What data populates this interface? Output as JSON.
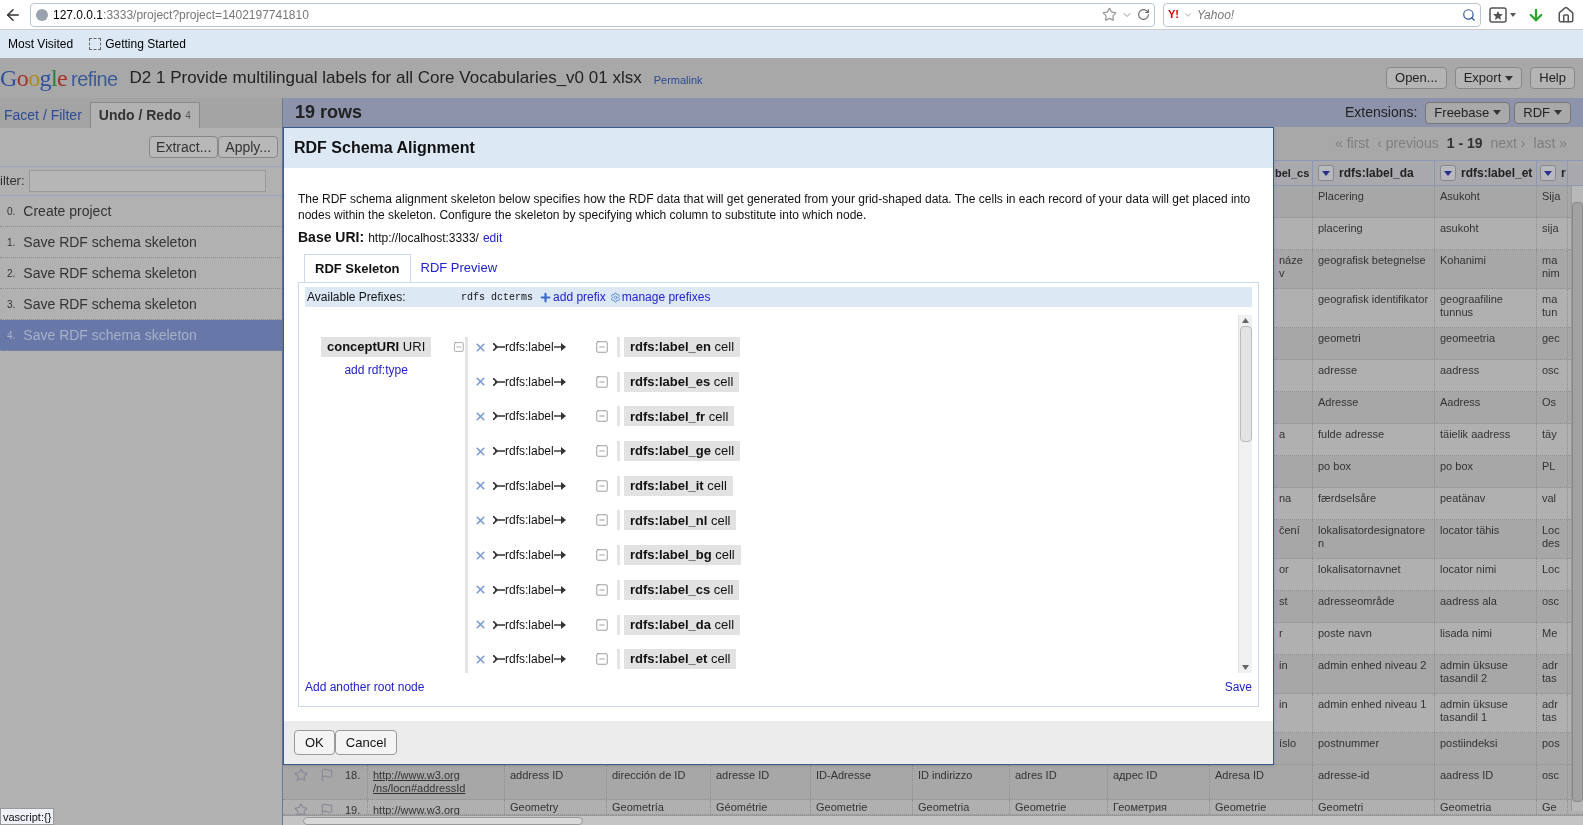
{
  "browser": {
    "url_host": "127.0.0.1",
    "url_rest": ":3333/project?project=1402197741810",
    "search": {
      "logo_text": "Y!",
      "placeholder": "Yahoo!"
    },
    "bookmarks": [
      "Most Visited",
      "Getting Started"
    ]
  },
  "app": {
    "logo": "Google",
    "logo_suffix": "refine",
    "project_title": "D2 1 Provide multilingual labels for all Core Vocabularies_v0 01 xlsx",
    "permalink": "Permalink",
    "buttons": [
      {
        "label": "Open...",
        "dropdown": false
      },
      {
        "label": "Export",
        "dropdown": true
      },
      {
        "label": "Help",
        "dropdown": false
      }
    ]
  },
  "left_panel": {
    "tabs": [
      {
        "label": "Facet / Filter",
        "selected": false
      },
      {
        "label": "Undo / Redo",
        "count": "4",
        "selected": true
      }
    ],
    "buttons": [
      "Extract...",
      "Apply..."
    ],
    "filter_label": "ilter:",
    "history": [
      {
        "number": "0.",
        "label": "Create project",
        "selected": false
      },
      {
        "number": "1.",
        "label": "Save RDF schema skeleton",
        "selected": false
      },
      {
        "number": "2.",
        "label": "Save RDF schema skeleton",
        "selected": false
      },
      {
        "number": "3.",
        "label": "Save RDF schema skeleton",
        "selected": false
      },
      {
        "number": "4.",
        "label": "Save RDF schema skeleton",
        "selected": true
      }
    ]
  },
  "grid": {
    "row_count": "19 rows",
    "extensions_label": "Extensions:",
    "extensions": [
      "Freebase",
      "RDF"
    ],
    "pager": {
      "first": "« first",
      "previous": "‹ previous",
      "range_start": "1",
      "range_sep": "-",
      "range_end": "19",
      "next": "next ›",
      "last": "last »"
    },
    "columns": [
      "bel_cs",
      "rdfs:label_da",
      "rdfs:label_et",
      "r"
    ],
    "rows": [
      {
        "cs": "",
        "da": "Placering",
        "et": "Asukoht",
        "col_4": [
          "Sija"
        ]
      },
      {
        "cs": "",
        "da": "placering",
        "et": "asukoht",
        "col_4": [
          "sija"
        ]
      },
      {
        "cs": "název",
        "da": "geografisk betegnelse",
        "et": "Kohanimi",
        "col_4": [
          "ma",
          "nim"
        ]
      },
      {
        "cs": "",
        "da": "geografisk identifikator",
        "et": "geograafiline tunnus",
        "col_4": [
          "ma",
          "tun"
        ]
      },
      {
        "cs": "",
        "da": "geometri",
        "et": "geomeetria",
        "col_4": [
          "gec"
        ]
      },
      {
        "cs": "",
        "da": "adresse",
        "et": "aadress",
        "col_4": [
          "osc"
        ]
      },
      {
        "cs": "",
        "da": "Adresse",
        "et": "Aadress",
        "col_4": [
          "Os"
        ]
      },
      {
        "cs": "a",
        "da": "fulde adresse",
        "et": "täielik aadress",
        "col_4": [
          "täy"
        ]
      },
      {
        "cs": "",
        "da": "po box",
        "et": "po box",
        "col_4": [
          "PL"
        ]
      },
      {
        "cs": "na",
        "da": "færdselsåre",
        "et": "peatänav",
        "col_4": [
          "val"
        ]
      },
      {
        "cs": "čení",
        "da": "lokalisatordesignatoren",
        "et": "locator tähis",
        "col_4": [
          "Loc",
          "des"
        ]
      },
      {
        "cs": "or",
        "da": "lokalisatornavnet",
        "et": "locator nimi",
        "col_4": [
          "Loc"
        ]
      },
      {
        "cs": "st",
        "da": "adresseområde",
        "et": "aadress ala",
        "col_4": [
          "osc"
        ]
      },
      {
        "cs": "r",
        "da": "poste navn",
        "et": "lisada nimi",
        "col_4": [
          "Me"
        ]
      },
      {
        "cs": "in",
        "da": "admin enhed niveau 2",
        "et": "admin üksuse tasandil 2",
        "col_4": [
          "adr",
          "tas"
        ]
      },
      {
        "cs": "in",
        "da": "admin enhed niveau 1",
        "et": "admin üksuse tasandil 1",
        "col_4": [
          "adr",
          "tas"
        ]
      },
      {
        "cs": "íslo",
        "da": "postnummer",
        "et": "postiindeksi",
        "col_4": [
          "pos"
        ]
      }
    ],
    "full_rows": [
      {
        "number": "18.",
        "link": [
          "http://www.w3.org",
          "/ns/locn#addressId"
        ],
        "cells": [
          "address ID",
          "dirección de ID",
          "adresse ID",
          "ID-Adresse",
          "ID indirizzo",
          "adres ID",
          "адрес ID",
          "Adresa ID",
          "adresse-id",
          "aadress ID",
          "osc"
        ]
      },
      {
        "number": "19.",
        "link": [
          "http://www.w3.org"
        ],
        "cells": [
          "Geometry",
          "Geometría",
          "Géométrie",
          "Geometrie",
          "Geometria",
          "Geometrie",
          "Геометрия",
          "Geometrie",
          "Geometri",
          "Geometria",
          "Ge"
        ]
      }
    ]
  },
  "dialog": {
    "title": "RDF Schema Alignment",
    "description": "The RDF schema alignment skeleton below specifies how the RDF data that will get generated from your grid-shaped data. The cells in each record of your data will get placed into nodes within the skeleton. Configure the skeleton by specifying which column to substitute into which node.",
    "base_uri_label": "Base URI:",
    "base_uri": "http://localhost:3333/",
    "edit": "edit",
    "tabs": [
      {
        "label": "RDF Skeleton",
        "selected": true
      },
      {
        "label": "RDF Preview",
        "selected": false
      }
    ],
    "prefixes_label": "Available Prefixes:",
    "prefixes": [
      "rdfs",
      "dcterms"
    ],
    "add_prefix": "add prefix",
    "manage_prefixes": "manage prefixes",
    "root": {
      "column": "conceptURI",
      "type": "URI",
      "add_type": "add rdf:type"
    },
    "links": [
      {
        "property": "rdfs:label",
        "column": "rdfs:label_en",
        "kind": "cell"
      },
      {
        "property": "rdfs:label",
        "column": "rdfs:label_es",
        "kind": "cell"
      },
      {
        "property": "rdfs:label",
        "column": "rdfs:label_fr",
        "kind": "cell"
      },
      {
        "property": "rdfs:label",
        "column": "rdfs:label_ge",
        "kind": "cell"
      },
      {
        "property": "rdfs:label",
        "column": "rdfs:label_it",
        "kind": "cell"
      },
      {
        "property": "rdfs:label",
        "column": "rdfs:label_nl",
        "kind": "cell"
      },
      {
        "property": "rdfs:label",
        "column": "rdfs:label_bg",
        "kind": "cell"
      },
      {
        "property": "rdfs:label",
        "column": "rdfs:label_cs",
        "kind": "cell"
      },
      {
        "property": "rdfs:label",
        "column": "rdfs:label_da",
        "kind": "cell"
      },
      {
        "property": "rdfs:label",
        "column": "rdfs:label_et",
        "kind": "cell"
      }
    ],
    "add_root": "Add another root node",
    "save": "Save",
    "buttons": [
      "OK",
      "Cancel"
    ]
  },
  "status_bar": "vascript:{}"
}
